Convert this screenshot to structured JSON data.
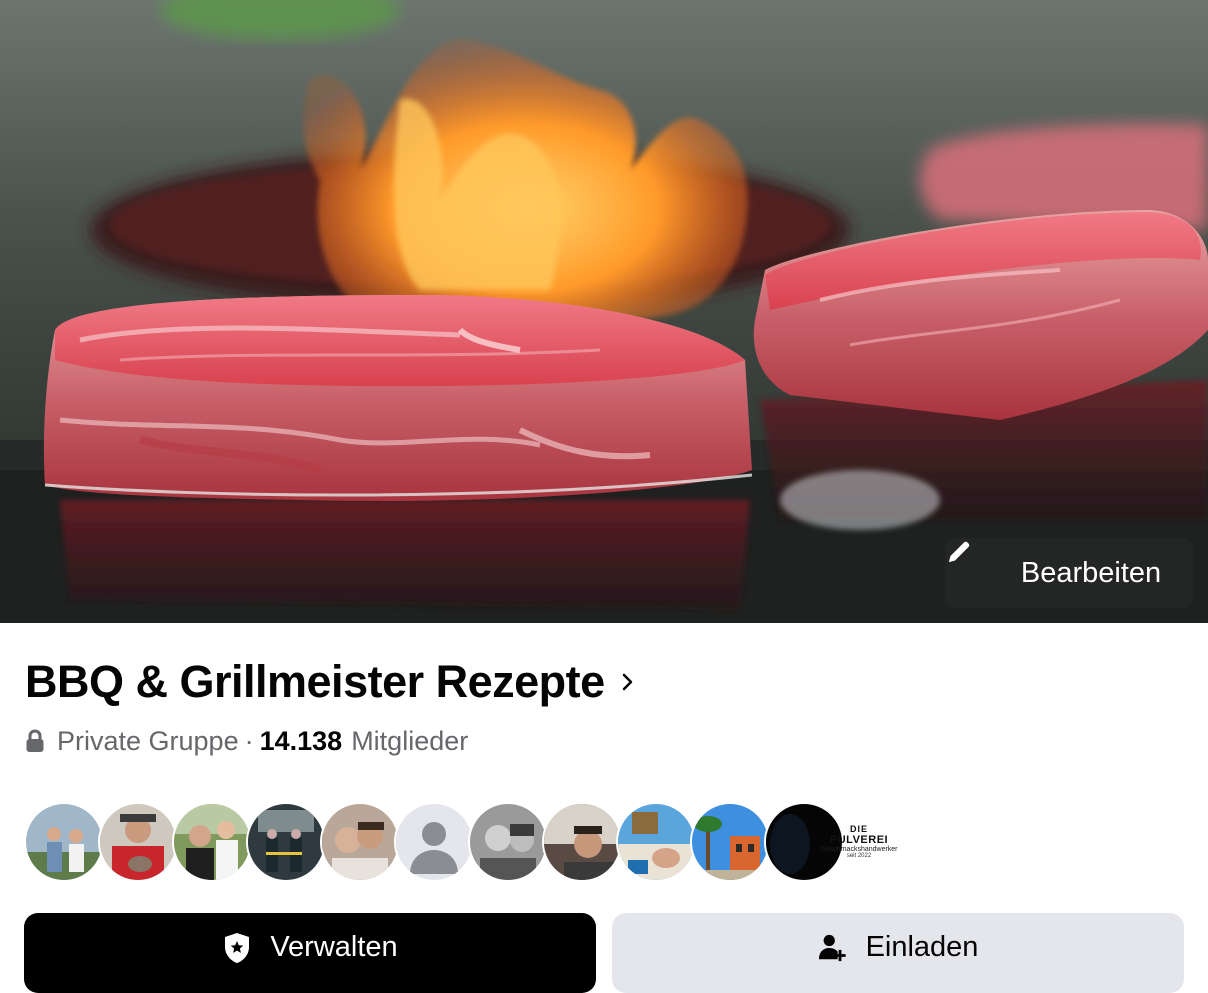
{
  "cover": {
    "edit_label": "Bearbeiten"
  },
  "group": {
    "name": "BBQ & Grillmeister Rezepte",
    "privacy": "Private Gruppe",
    "separator": "·",
    "member_count": "14.138",
    "member_label": "Mitglieder"
  },
  "member_logo": {
    "line1": "DIE",
    "line2": "PULVEREI",
    "line3": "Geschmackshandwerker",
    "line4": "seit 2022"
  },
  "actions": {
    "manage_label": "Verwalten",
    "invite_label": "Einladen"
  },
  "colors": {
    "manage_bg": "#000000",
    "invite_bg": "#e4e6eb",
    "secondary_text": "#65676b"
  },
  "icons": [
    "pencil-icon",
    "chevron-right-icon",
    "lock-icon",
    "shield-star-icon",
    "add-person-icon"
  ]
}
